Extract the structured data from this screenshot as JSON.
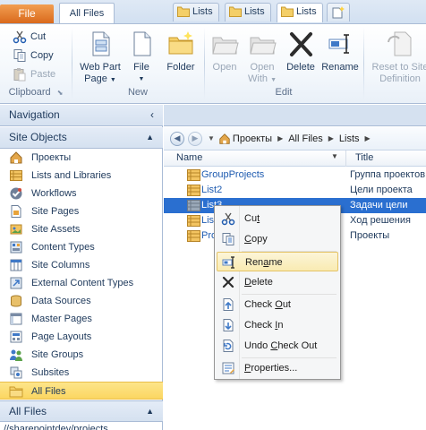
{
  "tabs": {
    "file": "File",
    "all_files": "All Files"
  },
  "ribbon": {
    "clipboard": {
      "cut": "Cut",
      "copy": "Copy",
      "paste": "Paste",
      "label": "Clipboard"
    },
    "new": {
      "web_part_page_l1": "Web Part",
      "web_part_page_l2": "Page",
      "file": "File",
      "folder": "Folder",
      "label": "New"
    },
    "edit": {
      "open": "Open",
      "open_with_l1": "Open",
      "open_with_l2": "With",
      "delete": "Delete",
      "rename": "Rename",
      "label": "Edit"
    },
    "reset": {
      "l1": "Reset to Site",
      "l2": "Definition"
    }
  },
  "nav": {
    "title": "Navigation",
    "site_objects": "Site Objects",
    "items": [
      {
        "label": "Проекты",
        "icon": "site-home-icon"
      },
      {
        "label": "Lists and Libraries",
        "icon": "lists-icon"
      },
      {
        "label": "Workflows",
        "icon": "workflow-icon"
      },
      {
        "label": "Site Pages",
        "icon": "site-pages-icon"
      },
      {
        "label": "Site Assets",
        "icon": "site-assets-icon"
      },
      {
        "label": "Content Types",
        "icon": "content-types-icon"
      },
      {
        "label": "Site Columns",
        "icon": "site-columns-icon"
      },
      {
        "label": "External Content Types",
        "icon": "external-content-icon"
      },
      {
        "label": "Data Sources",
        "icon": "data-sources-icon"
      },
      {
        "label": "Master Pages",
        "icon": "master-pages-icon"
      },
      {
        "label": "Page Layouts",
        "icon": "page-layouts-icon"
      },
      {
        "label": "Site Groups",
        "icon": "site-groups-icon"
      },
      {
        "label": "Subsites",
        "icon": "subsites-icon"
      },
      {
        "label": "All Files",
        "icon": "folder-icon"
      }
    ],
    "all_files_section": "All Files",
    "url_fragment": "//sharepointdev/projects"
  },
  "doc_tabs": [
    "Lists",
    "Lists",
    "Lists"
  ],
  "breadcrumb": [
    "Проекты",
    "All Files",
    "Lists"
  ],
  "columns": {
    "name": "Name",
    "title": "Title"
  },
  "rows": [
    {
      "name": "GroupProjects",
      "title": "Группа проектов"
    },
    {
      "name": "List2",
      "title": "Цели проекта"
    },
    {
      "name": "List3",
      "title": "Задачи цели"
    },
    {
      "name": "List",
      "title": "Ход решения"
    },
    {
      "name": "Pro",
      "title": "Проекты"
    }
  ],
  "context_menu": {
    "cut_pre": "Cu",
    "cut_u": "t",
    "cut_post": "",
    "copy_pre": "",
    "copy_u": "C",
    "copy_post": "opy",
    "rename_pre": "Ren",
    "rename_u": "a",
    "rename_post": "me",
    "delete_pre": "",
    "delete_u": "D",
    "delete_post": "elete",
    "checkout_pre": "Check ",
    "checkout_u": "O",
    "checkout_post": "ut",
    "checkin_pre": "Check ",
    "checkin_u": "I",
    "checkin_post": "n",
    "undo_pre": "Undo ",
    "undo_u": "C",
    "undo_post": "heck Out",
    "props_pre": "",
    "props_u": "P",
    "props_post": "roperties..."
  },
  "colors": {
    "accent": "#2a6fd0",
    "file_tab": "#d9691c",
    "selected_nav": "#fbd661"
  }
}
